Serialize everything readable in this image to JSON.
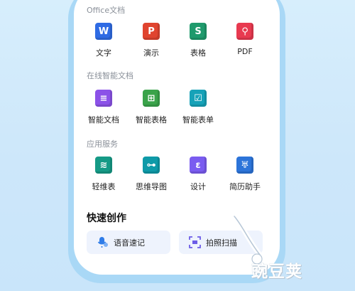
{
  "office_section": {
    "title": "Office文档",
    "items": [
      {
        "label": "文字",
        "icon": "word-doc-icon",
        "glyph": "W",
        "color": "#2f6be4"
      },
      {
        "label": "演示",
        "icon": "presentation-icon",
        "glyph": "P",
        "color": "#e0442f"
      },
      {
        "label": "表格",
        "icon": "spreadsheet-icon",
        "glyph": "S",
        "color": "#1f9a6c"
      },
      {
        "label": "PDF",
        "icon": "pdf-icon",
        "glyph": "⚲",
        "color": "#e83a50"
      }
    ]
  },
  "online_section": {
    "title": "在线智能文档",
    "items": [
      {
        "label": "智能文档",
        "icon": "smart-doc-icon",
        "glyph": "≡",
        "color": "#8b52e8"
      },
      {
        "label": "智能表格",
        "icon": "smart-sheet-icon",
        "glyph": "⊞",
        "color": "#3aa34a"
      },
      {
        "label": "智能表单",
        "icon": "smart-form-icon",
        "glyph": "☑",
        "color": "#16a2b8"
      }
    ]
  },
  "services_section": {
    "title": "应用服务",
    "items": [
      {
        "label": "轻维表",
        "icon": "light-table-icon",
        "glyph": "≋",
        "color": "#159a86"
      },
      {
        "label": "思维导图",
        "icon": "mind-map-icon",
        "glyph": "⊶",
        "color": "#0e9aa8"
      },
      {
        "label": "设计",
        "icon": "design-icon",
        "glyph": "ε",
        "color": "#7a5cf0"
      },
      {
        "label": "简历助手",
        "icon": "resume-icon",
        "glyph": "♅",
        "color": "#2c74d9"
      }
    ]
  },
  "quick_create": {
    "title": "快速创作",
    "buttons": [
      {
        "label": "语音速记",
        "icon": "microphone-icon"
      },
      {
        "label": "拍照扫描",
        "icon": "scan-icon"
      }
    ]
  },
  "watermark": {
    "text": "豌豆荚",
    "icon": "pea-logo-icon"
  }
}
